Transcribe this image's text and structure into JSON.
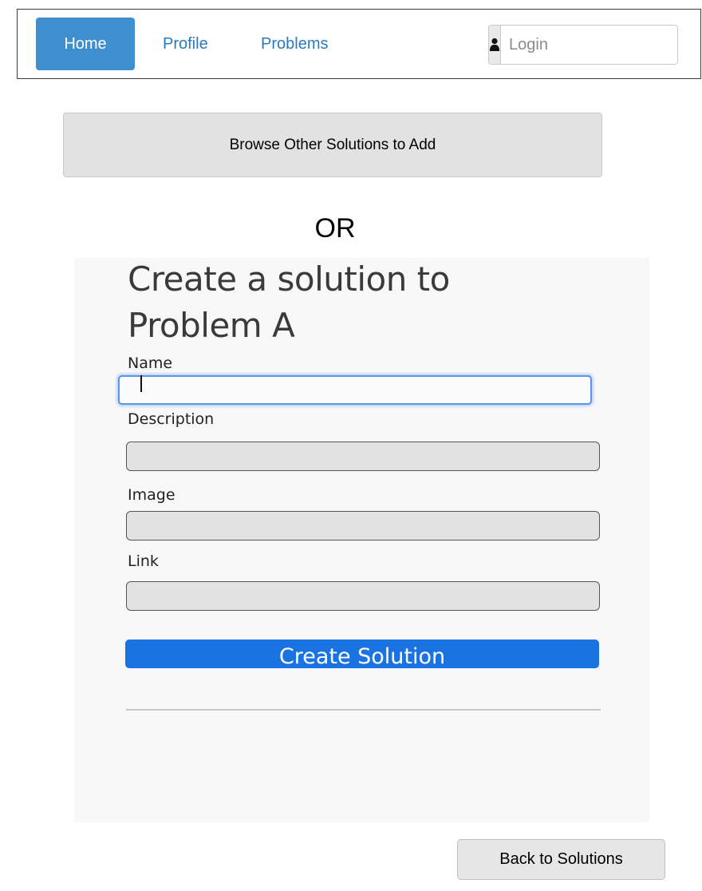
{
  "nav": {
    "home_label": "Home",
    "profile_label": "Profile",
    "problems_label": "Problems",
    "login_placeholder": "Login",
    "login_icon": "user-icon"
  },
  "browse_button_label": "Browse Other Solutions to Add",
  "or_label": "OR",
  "form": {
    "title": "Create a solution to Problem A",
    "fields": [
      {
        "label": "Name",
        "value": ""
      },
      {
        "label": "Description",
        "value": ""
      },
      {
        "label": "Image",
        "value": ""
      },
      {
        "label": "Link",
        "value": ""
      }
    ],
    "submit_label": "Create Solution"
  },
  "back_button_label": "Back to Solutions",
  "colors": {
    "nav_active": "#3d8fcf",
    "nav_link": "#2a7ac2",
    "primary_button": "#1a73e0",
    "focus_ring": "#5b95e8"
  }
}
